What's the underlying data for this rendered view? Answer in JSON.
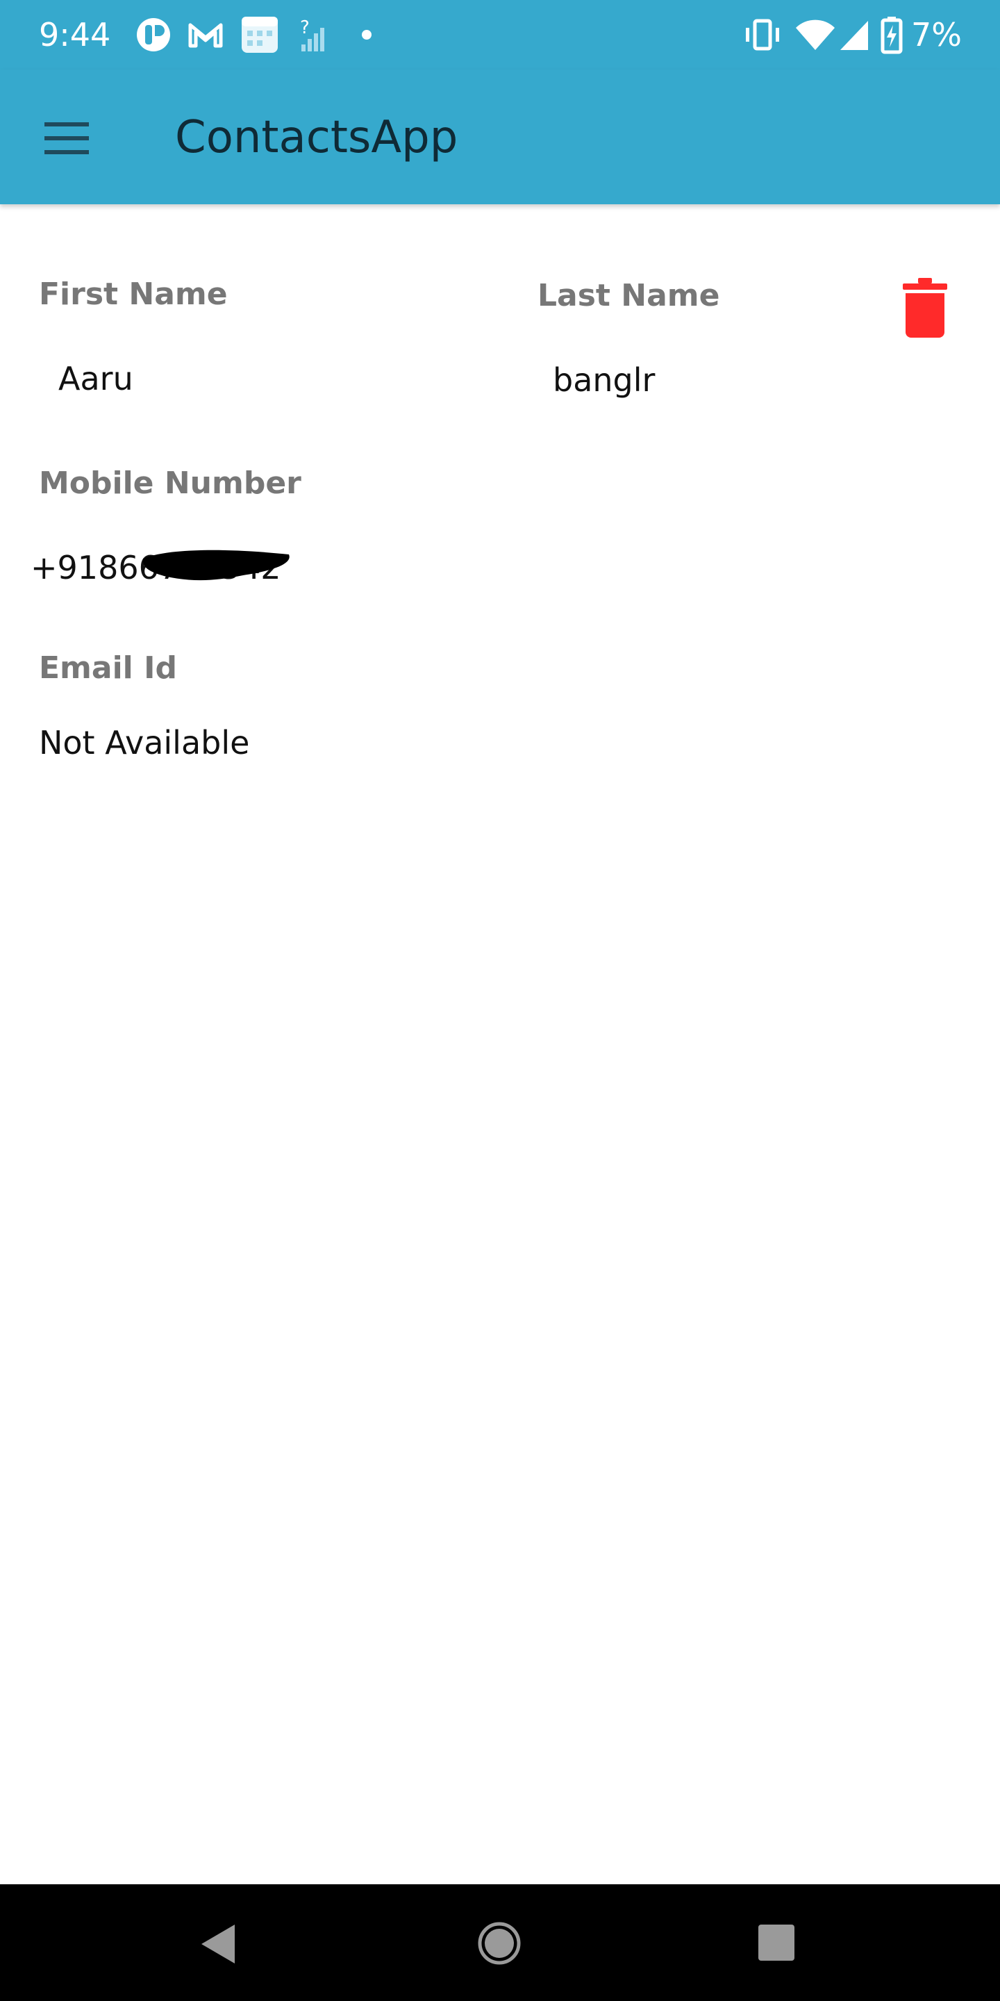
{
  "status_bar": {
    "time": "9:44",
    "battery_percent": "7%",
    "icons": [
      "app-notification-icon",
      "gmail-icon",
      "calendar-icon",
      "no-signal-icon",
      "dot-icon",
      "vibrate-icon",
      "wifi-icon",
      "signal-icon",
      "battery-charging-icon"
    ]
  },
  "app_bar": {
    "title": "ContactsApp",
    "menu_icon": "hamburger-menu-icon"
  },
  "contact": {
    "first_name_label": "First Name",
    "first_name_value": "Aaru",
    "last_name_label": "Last Name",
    "last_name_value": "banglr",
    "mobile_label": "Mobile Number",
    "mobile_value": "+91866712342",
    "email_label": "Email Id",
    "email_value": "Not Available",
    "delete_icon": "trash-icon"
  },
  "nav_bar": {
    "icons": [
      "back-icon",
      "home-icon",
      "recents-icon"
    ]
  },
  "colors": {
    "primary": "#36a9cd",
    "delete": "#ff2a2a",
    "label": "#777777"
  }
}
